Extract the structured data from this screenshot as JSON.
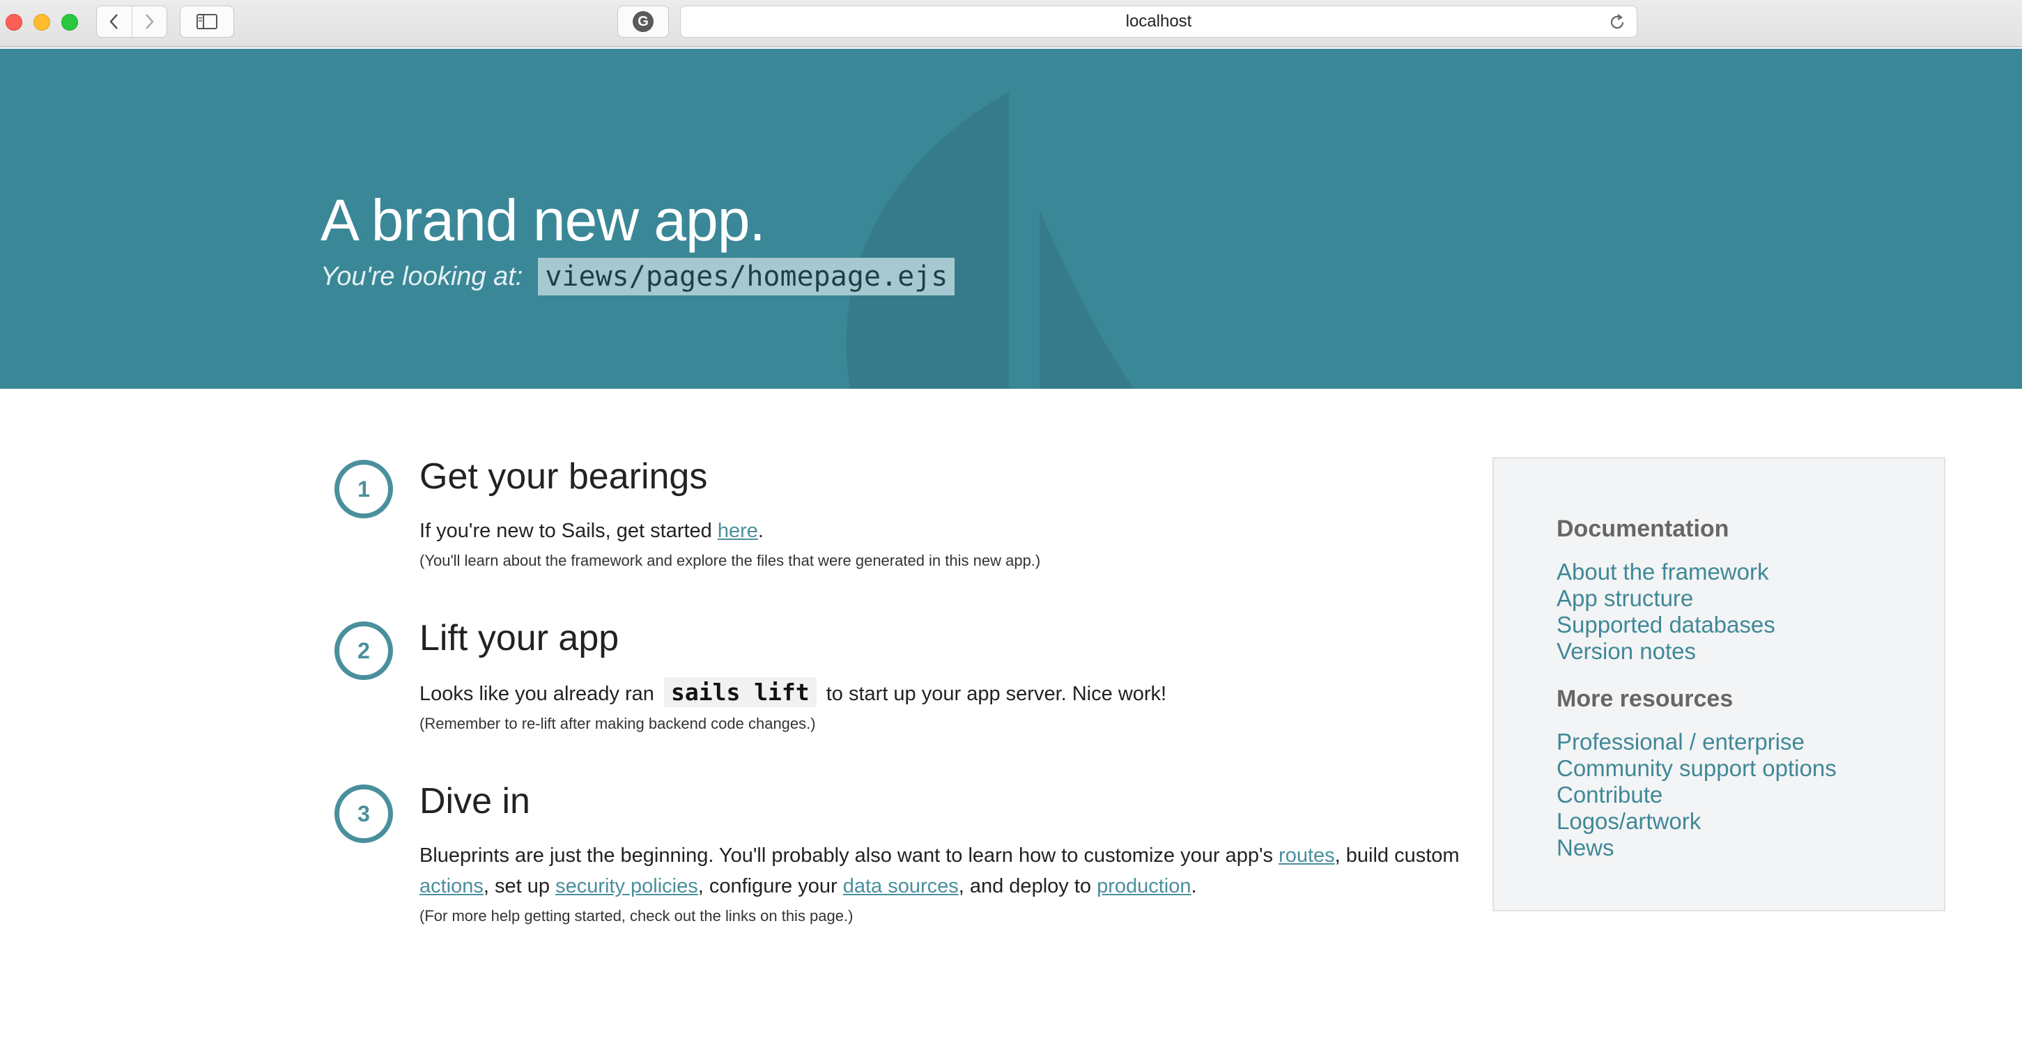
{
  "browser": {
    "url": "localhost"
  },
  "hero": {
    "title": "A brand new app.",
    "subtitle_label": "You're looking at:",
    "file_path": "views/pages/homepage.ejs",
    "background_color": "#3a8797"
  },
  "steps": [
    {
      "number": "1",
      "title": "Get your bearings",
      "text_before": "If you're new to Sails, get started ",
      "link": "here",
      "text_after": ".",
      "note": "(You'll learn about the framework and explore the files that were generated in this new app.)"
    },
    {
      "number": "2",
      "title": "Lift your app",
      "text_before": "Looks like you already ran ",
      "code": "sails lift",
      "text_after": " to start up your app server. Nice work!",
      "note": "(Remember to re-lift after making backend code changes.)"
    },
    {
      "number": "3",
      "title": "Dive in",
      "text_1": "Blueprints are just the beginning. You'll probably also want to learn how to customize your app's ",
      "link_routes": "routes",
      "text_2": ", build custom ",
      "link_actions": "actions",
      "text_3": ", set up ",
      "link_security": "security policies",
      "text_4": ", configure your ",
      "link_datasources": "data sources",
      "text_5": ", and deploy to ",
      "link_production": "production",
      "text_6": ".",
      "note": "(For more help getting started, check out the links on this page.)"
    }
  ],
  "sidebar": {
    "documentation_heading": "Documentation",
    "documentation_links": [
      "About the framework",
      "App structure",
      "Supported databases",
      "Version notes"
    ],
    "resources_heading": "More resources",
    "resources_links": [
      "Professional / enterprise",
      "Community support options",
      "Contribute",
      "Logos/artwork",
      "News"
    ]
  },
  "colors": {
    "accent": "#4a8f9c",
    "link": "#3f8898"
  }
}
